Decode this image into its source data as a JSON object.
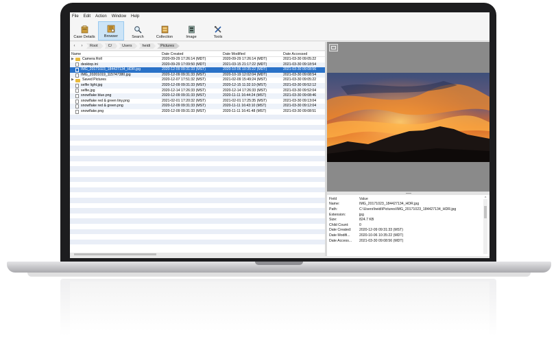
{
  "menu": [
    "File",
    "Edit",
    "Action",
    "Window",
    "Help"
  ],
  "toolbar": [
    {
      "label": "Case Details",
      "icon": "case-details-icon",
      "active": false
    },
    {
      "label": "Browser",
      "icon": "browser-icon",
      "active": true
    },
    {
      "label": "Search",
      "icon": "search-icon",
      "active": false
    },
    {
      "label": "Collection",
      "icon": "collection-icon",
      "active": false
    },
    {
      "label": "Image",
      "icon": "image-icon",
      "active": false
    },
    {
      "label": "Tools",
      "icon": "tools-icon",
      "active": false
    }
  ],
  "breadcrumb": [
    "Root",
    "C/",
    "Users",
    "heidi",
    "Pictures"
  ],
  "table": {
    "columns": [
      "Name",
      "Date Created",
      "Date Modified",
      "Date Accessed"
    ],
    "rows": [
      {
        "name": "Camera Roll",
        "type": "folder",
        "expandable": true,
        "created": "2020-09-29 17:26:14 (MDT)",
        "modified": "2020-09-29 17:26:14 (MDT)",
        "accessed": "2021-03-30 09:05:22"
      },
      {
        "name": "desktop.ini",
        "type": "file",
        "expandable": false,
        "created": "2020-09-29 17:09:50 (MDT)",
        "modified": "2021-03-15 21:17:22 (MDT)",
        "accessed": "2021-03-30 09:18:54"
      },
      {
        "name": "IMG_20171023_184427134_HDR.jpg",
        "type": "file",
        "expandable": false,
        "selected": true,
        "created": "2020-12-09 09:31:33 (MST)",
        "modified": "2020-10-06 10:35:22 (MDT)",
        "accessed": "2021-03-30 09:08:56"
      },
      {
        "name": "IMG_20201019_115747380.jpg",
        "type": "file",
        "expandable": false,
        "created": "2020-12-09 09:31:33 (MST)",
        "modified": "2020-10-19 12:02:04 (MDT)",
        "accessed": "2021-03-30 09:08:54"
      },
      {
        "name": "Saved Pictures",
        "type": "folder",
        "expandable": true,
        "created": "2020-12-07 17:51:32 (MST)",
        "modified": "2021-02-09 15:49:24 (MST)",
        "accessed": "2021-03-30 09:05:22"
      },
      {
        "name": "selfie light.jpg",
        "type": "file",
        "expandable": false,
        "created": "2020-12-09 09:31:33 (MST)",
        "modified": "2020-12-15 11:32:10 (MST)",
        "accessed": "2021-03-30 09:52:12"
      },
      {
        "name": "selfie.jpg",
        "type": "file",
        "expandable": false,
        "created": "2020-12-14 17:26:33 (MST)",
        "modified": "2020-12-14 17:26:33 (MST)",
        "accessed": "2021-03-30 09:52:04"
      },
      {
        "name": "snowflake blue.png",
        "type": "file",
        "expandable": false,
        "created": "2020-12-09 09:31:33 (MST)",
        "modified": "2020-11-11 16:44:24 (MST)",
        "accessed": "2021-03-30 09:08:46"
      },
      {
        "name": "snowflake red & green tiny.png",
        "type": "file",
        "expandable": false,
        "created": "2021-02-01 17:20:32 (MST)",
        "modified": "2021-02-01 17:25:35 (MST)",
        "accessed": "2021-03-30 09:13:04"
      },
      {
        "name": "snowflake red & green.png",
        "type": "file",
        "expandable": false,
        "created": "2020-12-09 09:31:33 (MST)",
        "modified": "2020-11-11 16:43:10 (MST)",
        "accessed": "2021-03-30 09:12:04"
      },
      {
        "name": "snowflake.png",
        "type": "file",
        "expandable": false,
        "created": "2020-12-09 09:31:33 (MST)",
        "modified": "2020-11-11 16:41:48 (MST)",
        "accessed": "2021-03-30 09:08:51"
      }
    ]
  },
  "properties": {
    "header": {
      "field": "Field",
      "value": "Value"
    },
    "rows": [
      {
        "field": "Name:",
        "value": "IMG_20171023_184427134_HDR.jpg"
      },
      {
        "field": "Path:",
        "value": "C:\\Users\\heidi\\Pictures\\IMG_20171023_184427134_HDR.jpg"
      },
      {
        "field": "Extension:",
        "value": "jpg"
      },
      {
        "field": "Size:",
        "value": "824.7 KB"
      },
      {
        "field": "Child Count:",
        "value": "0"
      },
      {
        "field": "Date Created:",
        "value": "2020-12-09 09:31:33 (MST)"
      },
      {
        "field": "Date Modifi...",
        "value": "2020-10-06 10:35:22 (MDT)"
      },
      {
        "field": "Date Access...",
        "value": "2021-03-30 09:08:56 (MDT)"
      }
    ]
  },
  "colors": {
    "selection": "#2a72c8",
    "folder": "#e8b93c",
    "active_tool": "#cce4f7"
  }
}
